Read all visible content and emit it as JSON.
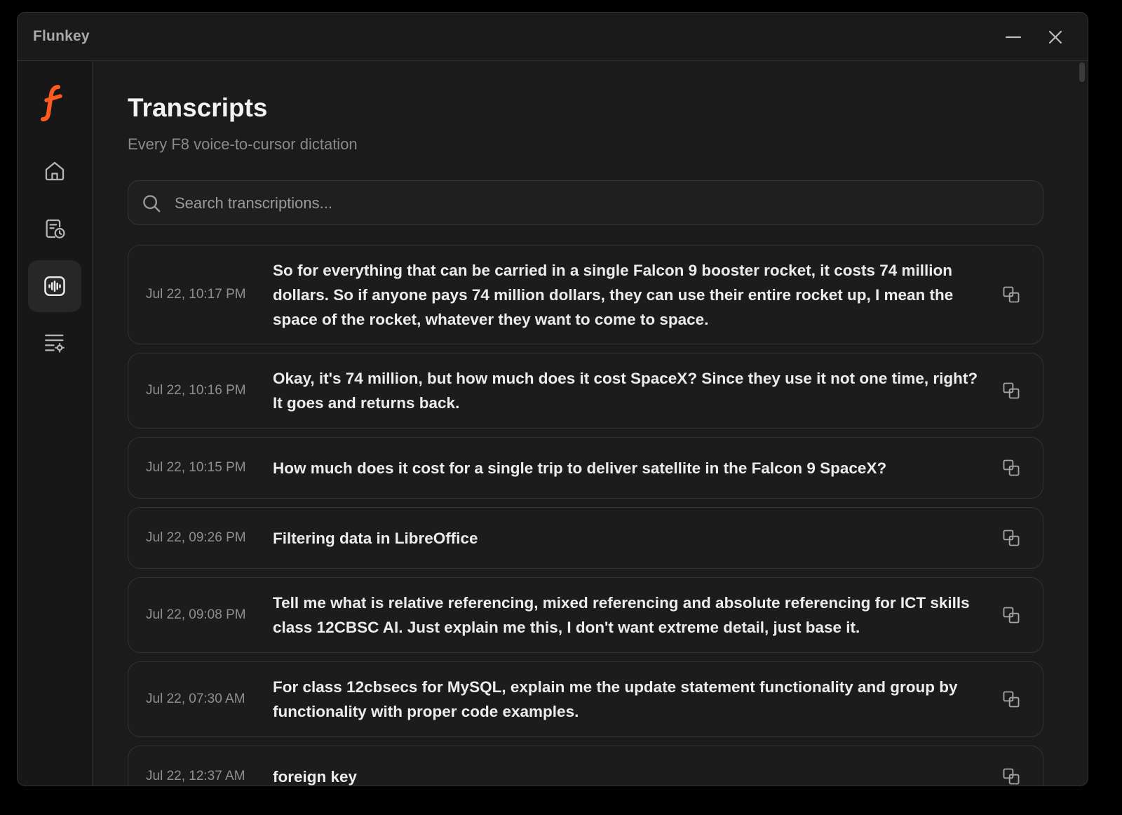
{
  "window": {
    "title": "Flunkey"
  },
  "sidebar": {
    "items": [
      {
        "name": "home",
        "icon": "home-icon",
        "active": false
      },
      {
        "name": "history",
        "icon": "history-icon",
        "active": false
      },
      {
        "name": "transcripts",
        "icon": "audio-waveform-icon",
        "active": true
      },
      {
        "name": "settings",
        "icon": "list-settings-icon",
        "active": false
      }
    ]
  },
  "page": {
    "title": "Transcripts",
    "subtitle": "Every F8 voice-to-cursor dictation"
  },
  "search": {
    "placeholder": "Search transcriptions...",
    "value": ""
  },
  "transcripts": [
    {
      "time": "Jul 22, 10:17 PM",
      "text": "So for everything that can be carried in a single Falcon 9 booster rocket, it costs 74 million dollars. So if anyone pays 74 million dollars, they can use their entire rocket up, I mean the space of the rocket, whatever they want to come to space."
    },
    {
      "time": "Jul 22, 10:16 PM",
      "text": "Okay, it's 74 million, but how much does it cost SpaceX? Since they use it not one time, right? It goes and returns back."
    },
    {
      "time": "Jul 22, 10:15 PM",
      "text": "How much does it cost for a single trip to deliver satellite in the Falcon 9 SpaceX?"
    },
    {
      "time": "Jul 22, 09:26 PM",
      "text": "Filtering data in LibreOffice"
    },
    {
      "time": "Jul 22, 09:08 PM",
      "text": "Tell me what is relative referencing, mixed referencing and absolute referencing for ICT skills class 12CBSC AI. Just explain me this, I don't want extreme detail, just base it."
    },
    {
      "time": "Jul 22, 07:30 AM",
      "text": "For class 12cbsecs for MySQL, explain me the update statement functionality and group by functionality with proper code examples."
    },
    {
      "time": "Jul 22, 12:37 AM",
      "text": "foreign key"
    }
  ],
  "colors": {
    "accent": "#ff5a1f",
    "background": "#1b1b1b",
    "sidebar": "#171717",
    "border": "#323232"
  }
}
